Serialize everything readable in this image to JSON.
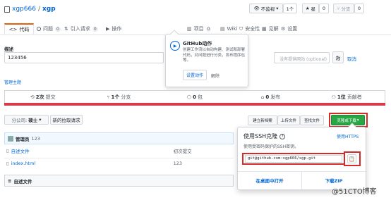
{
  "repo": {
    "owner": "xgp666",
    "sep": "/",
    "name": "xgp"
  },
  "actions": {
    "watch": {
      "label": "不监视",
      "count": "1个"
    },
    "star": {
      "label": "星",
      "count": "0"
    },
    "fork": {
      "label": "分支",
      "count": "0"
    }
  },
  "tabs": [
    "代码",
    "问题",
    "引入请求",
    "操作",
    "项目",
    "Wiki",
    "安全性",
    "见解",
    "设置"
  ],
  "tab_counts": {
    "issues": "0",
    "pulls": "0",
    "projects": "0"
  },
  "about": {
    "label": "描述",
    "value": "123456",
    "website_placeholder": "没有提供网站 (optional)",
    "save": "救",
    "cancel": "取消",
    "manage_topics": "管理主题"
  },
  "actions_popup": {
    "title": "GitHub动作",
    "body": "创建工作流以自动构建、测试和部署代码，对问题进行分类，发布程序包等。",
    "setup": "设置动作",
    "dismiss": "解除"
  },
  "stats": [
    {
      "num": "2次",
      "label": "提交"
    },
    {
      "num": "1个",
      "label": "分支"
    },
    {
      "num": "0",
      "label": "包"
    },
    {
      "num": "0",
      "label": "发布"
    },
    {
      "num": "1位",
      "label": "贡献者"
    }
  ],
  "branch": {
    "label": "分公司:",
    "value": "硕士"
  },
  "new_pull": "新的拉取请求",
  "file_buttons": {
    "create": "建立新档案",
    "upload": "上传文件",
    "find": "查找文件",
    "clone": "克隆或下载"
  },
  "commit": {
    "author": "管理员",
    "message": "123"
  },
  "files": [
    {
      "name": "自述文件",
      "message": "初次提交"
    },
    {
      "name": "index.html",
      "message": "123"
    }
  ],
  "readme_title": "自述文件",
  "clone": {
    "title": "使用SSH克隆",
    "desc": "使用受密码保护的SSH密钥。",
    "switch": "使用HTTPS",
    "url": "git@github.com:xgp666/xgp.git",
    "desktop": "在桌面中打开",
    "zip": "下载ZIP"
  },
  "watermark": "@51CTO博客",
  "colors": {
    "accent": "#0366d6",
    "highlight": "#d52a2a",
    "clone_green": "#28a745",
    "red_bar": "#d73a49"
  }
}
